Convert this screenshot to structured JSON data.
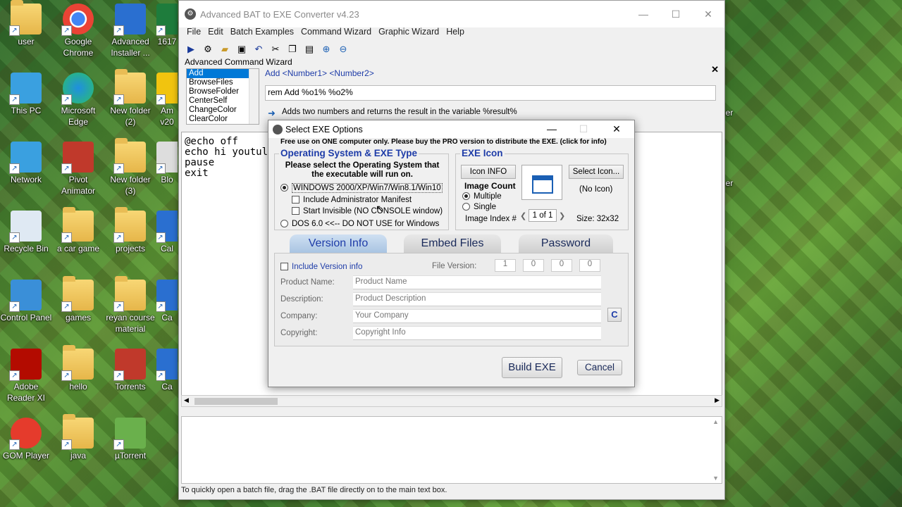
{
  "desktop": {
    "icons": [
      {
        "label": "user",
        "name": "user-folder-icon"
      },
      {
        "label": "Google Chrome",
        "name": "chrome-icon"
      },
      {
        "label": "Advanced Installer ...",
        "name": "advanced-installer-icon"
      },
      {
        "label": "1617",
        "name": "partial-icon-1617"
      },
      {
        "label": "This PC",
        "name": "this-pc-icon"
      },
      {
        "label": "Microsoft Edge",
        "name": "edge-icon"
      },
      {
        "label": "New folder (2)",
        "name": "new-folder-2-icon"
      },
      {
        "label": "Am v20",
        "name": "partial-icon-am"
      },
      {
        "label": "Network",
        "name": "network-icon"
      },
      {
        "label": "Pivot Animator",
        "name": "pivot-animator-icon"
      },
      {
        "label": "New folder (3)",
        "name": "new-folder-3-icon"
      },
      {
        "label": "Blo",
        "name": "partial-icon-blo"
      },
      {
        "label": "Recycle Bin",
        "name": "recycle-bin-icon"
      },
      {
        "label": "a car game",
        "name": "car-game-icon"
      },
      {
        "label": "projects",
        "name": "projects-folder-icon"
      },
      {
        "label": "Cal",
        "name": "partial-icon-cal"
      },
      {
        "label": "Control Panel",
        "name": "control-panel-icon"
      },
      {
        "label": "games",
        "name": "games-folder-icon"
      },
      {
        "label": "reyan course material",
        "name": "course-folder-icon"
      },
      {
        "label": "Ca",
        "name": "partial-icon-ca"
      },
      {
        "label": "Adobe Reader XI",
        "name": "adobe-reader-icon"
      },
      {
        "label": "hello",
        "name": "hello-file-icon"
      },
      {
        "label": "Torrents",
        "name": "torrents-icon"
      },
      {
        "label": "Ca",
        "name": "partial-icon-ca2"
      },
      {
        "label": "GOM Player",
        "name": "gom-player-icon"
      },
      {
        "label": "java",
        "name": "java-file-icon"
      },
      {
        "label": "µTorrent",
        "name": "utorrent-icon"
      }
    ],
    "right_labels": [
      "er",
      "er"
    ]
  },
  "app": {
    "title": "Advanced BAT to EXE Converter v4.23",
    "menu": [
      "File",
      "Edit",
      "Batch Examples",
      "Command Wizard",
      "Graphic Wizard",
      "Help"
    ],
    "wizard_title": "Advanced Command Wizard",
    "commands": [
      "Add",
      "BrowseFiles",
      "BrowseFolder",
      "CenterSelf",
      "ChangeColor",
      "ClearColor"
    ],
    "syntax": "Add <Number1> <Number2>",
    "command_line": "rem Add %o1% %o2%",
    "hint": "Adds two numbers and returns the result in the variable %result%",
    "editor_text": "@echo off\necho hi youtul\npause\nexit",
    "status": "To quickly open a batch file, drag the .BAT file directly on to the main text box."
  },
  "dialog": {
    "title": "Select EXE Options",
    "free_notice": "Free use on ONE computer only. Please buy the PRO version to distribute the EXE. (click for info)",
    "os_group": "Operating System & EXE Type",
    "os_prompt": "Please select the Operating System that the executable will run on.",
    "os_windows": "WINDOWS 2000/XP/Win7/Win8.1/Win10",
    "admin_manifest": "Include Administrator Manifest",
    "start_invisible": "Start Invisible   (NO CONSOLE window)",
    "os_dos": "DOS 6.0 <<-- DO NOT USE for Windows",
    "icon_group": "EXE Icon",
    "icon_info": "Icon INFO",
    "select_icon": "Select Icon...",
    "no_icon": "(No Icon)",
    "image_count": "Image Count",
    "multiple": "Multiple",
    "single": "Single",
    "image_index": "Image Index #",
    "index_value": "1 of 1",
    "size": "Size: 32x32",
    "tabs": [
      "Version Info",
      "Embed Files",
      "Password"
    ],
    "include_version": "Include Version info",
    "file_version_label": "File Version:",
    "file_version": [
      "1",
      "0",
      "0",
      "0"
    ],
    "fields": [
      {
        "label": "Product Name:",
        "placeholder": "Product Name"
      },
      {
        "label": "Description:",
        "placeholder": "Product Description"
      },
      {
        "label": "Company:",
        "placeholder": "Your Company"
      },
      {
        "label": "Copyright:",
        "placeholder": "Copyright Info"
      }
    ],
    "c_button": "C",
    "build": "Build EXE",
    "cancel": "Cancel"
  }
}
